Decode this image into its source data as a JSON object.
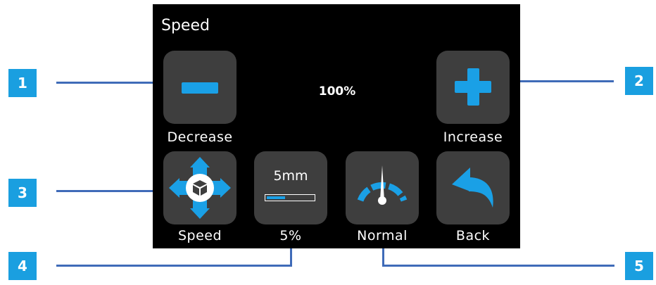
{
  "screen": {
    "title": "Speed",
    "value": "100%",
    "buttons": {
      "decrease": "Decrease",
      "increase": "Increase",
      "mode": "Speed",
      "step": "5%",
      "speed_preset": "Normal",
      "back": "Back"
    },
    "step_button": {
      "text": "5mm",
      "progress": 0.4
    }
  },
  "callouts": [
    "1",
    "2",
    "3",
    "4",
    "5"
  ],
  "colors": {
    "accent": "#1aa0e6",
    "button_bg": "#3e3e3e",
    "screen_bg": "#000000",
    "callout_bg": "#1a9fe0",
    "leader_line": "#3f6bb8"
  },
  "icons": {
    "decrease": "minus-icon",
    "increase": "plus-icon",
    "mode": "move-axes-icon",
    "speed_preset": "speedometer-icon",
    "back": "back-arrow-icon"
  }
}
